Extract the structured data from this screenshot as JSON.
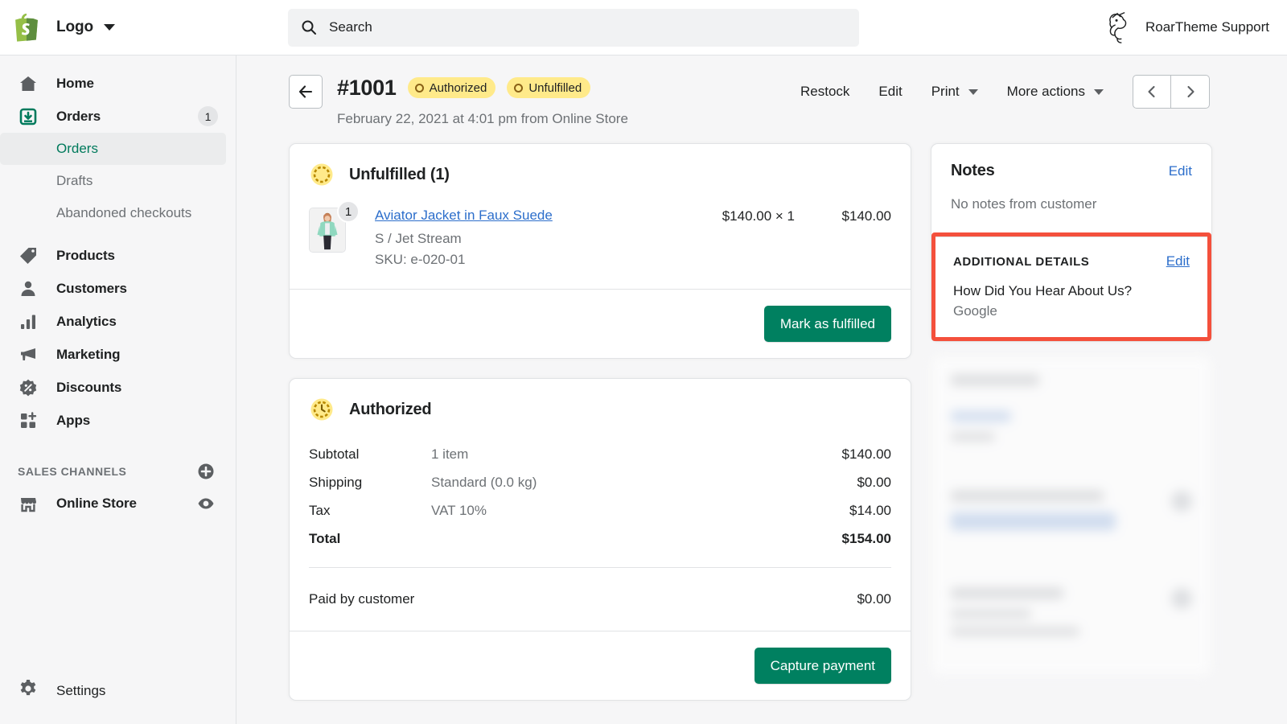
{
  "topbar": {
    "logo_icon": "shopify-bag-icon",
    "brand_label": "Logo",
    "caret_icon": "chevron-down-icon",
    "search": {
      "icon": "search-icon",
      "value": "",
      "placeholder": "Search"
    },
    "user": {
      "avatar_icon": "roartheme-lion-avatar-icon",
      "name": "RoarTheme Support"
    }
  },
  "sidebar": {
    "items": [
      {
        "label": "Home",
        "icon": "home-icon",
        "badge": ""
      },
      {
        "label": "Orders",
        "icon": "orders-inbox-icon",
        "badge": "1"
      },
      {
        "label": "Products",
        "icon": "products-tag-icon",
        "badge": ""
      },
      {
        "label": "Customers",
        "icon": "customers-person-icon",
        "badge": ""
      },
      {
        "label": "Analytics",
        "icon": "analytics-bars-icon",
        "badge": ""
      },
      {
        "label": "Marketing",
        "icon": "marketing-megaphone-icon",
        "badge": ""
      },
      {
        "label": "Discounts",
        "icon": "discounts-percent-icon",
        "badge": ""
      },
      {
        "label": "Apps",
        "icon": "apps-grid-plus-icon",
        "badge": ""
      }
    ],
    "orders_sub_items": [
      {
        "label": "Orders",
        "active": true
      },
      {
        "label": "Drafts",
        "active": false
      },
      {
        "label": "Abandoned checkouts",
        "active": false
      }
    ],
    "sales_channels": {
      "title": "SALES CHANNELS",
      "add_icon": "plus-circle-icon",
      "channels": [
        {
          "label": "Online Store",
          "icon": "storefront-icon",
          "action_icon": "eye-icon"
        }
      ]
    },
    "settings": {
      "label": "Settings",
      "icon": "gear-icon"
    }
  },
  "page_header": {
    "back_icon": "arrow-left-icon",
    "order_number": "#1001",
    "badges": [
      {
        "label": "Authorized",
        "color": "#ffea8a"
      },
      {
        "label": "Unfulfilled",
        "color": "#ffea8a"
      }
    ],
    "subtitle": "February 22, 2021 at 4:01 pm from Online Store",
    "actions": [
      {
        "label": "Restock",
        "has_caret": false
      },
      {
        "label": "Edit",
        "has_caret": false
      },
      {
        "label": "Print",
        "has_caret": true
      },
      {
        "label": "More actions",
        "has_caret": true
      }
    ],
    "pagination": {
      "prev_icon": "chevron-left-icon",
      "next_icon": "chevron-right-icon"
    }
  },
  "fulfillment_card": {
    "status_icon": "unfulfilled-dashed-circle-icon",
    "title": "Unfulfilled (1)",
    "line_items": [
      {
        "quantity": "1",
        "name": "Aviator Jacket in Faux Suede",
        "variant": "S / Jet Stream",
        "sku": "SKU: e-020-01",
        "unit_price": "$140.00 × 1",
        "line_total": "$140.00"
      }
    ],
    "action_label": "Mark as fulfilled"
  },
  "payment_card": {
    "status_icon": "authorized-clock-icon",
    "title": "Authorized",
    "rows": [
      {
        "label": "Subtotal",
        "description": "1 item",
        "value": "$140.00",
        "bold": false
      },
      {
        "label": "Shipping",
        "description": "Standard (0.0 kg)",
        "value": "$0.00",
        "bold": false
      },
      {
        "label": "Tax",
        "description": "VAT 10%",
        "value": "$14.00",
        "bold": false
      },
      {
        "label": "Total",
        "description": "",
        "value": "$154.00",
        "bold": true
      }
    ],
    "paid_row": {
      "label": "Paid by customer",
      "value": "$0.00"
    },
    "action_label": "Capture payment"
  },
  "notes_card": {
    "title": "Notes",
    "edit_label": "Edit",
    "body": "No notes from customer"
  },
  "additional_details": {
    "title": "ADDITIONAL DETAILS",
    "edit_label": "Edit",
    "question": "How Did You Hear About Us?",
    "answer": "Google",
    "highlight_color": "#f4503c"
  },
  "colors": {
    "accent_green": "#008060",
    "link_blue": "#2c6ecb",
    "badge_yellow": "#ffea8a",
    "highlight_red": "#f4503c",
    "sidebar_bg": "#f6f6f7"
  }
}
